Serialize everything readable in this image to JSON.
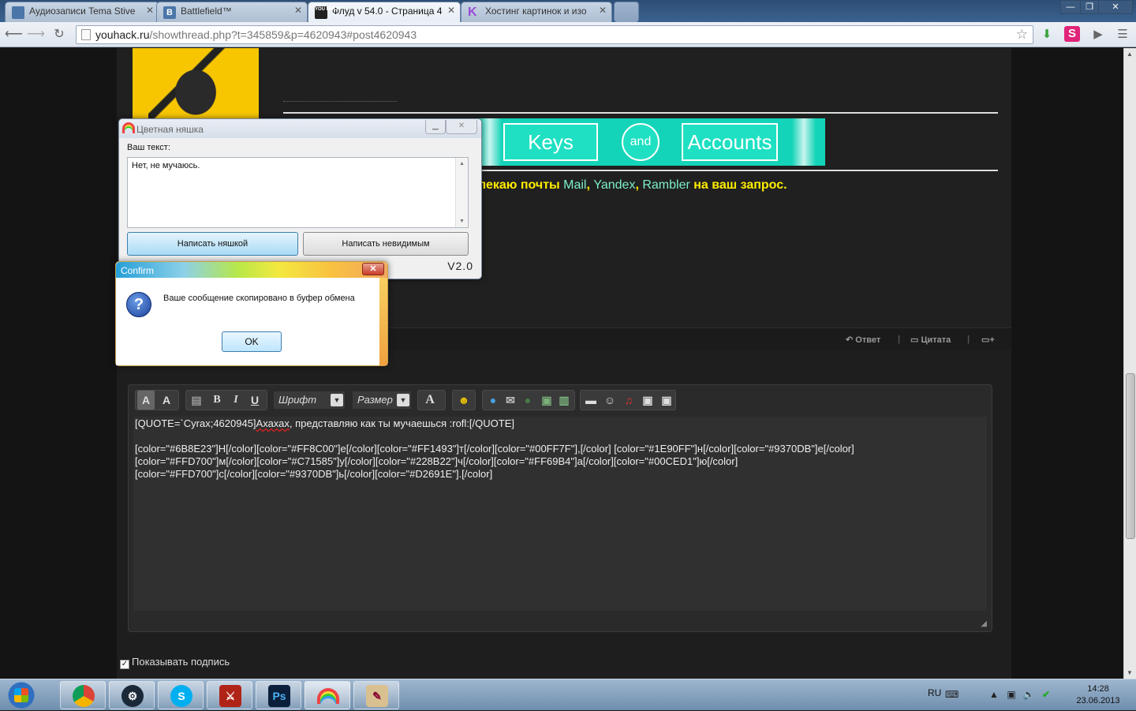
{
  "browser": {
    "tabs": [
      {
        "title": "Аудиозаписи Tema Stive",
        "favicon": "play-icon",
        "color": "#4a76a8"
      },
      {
        "title": "Battlefield™",
        "favicon": "vk-icon",
        "color": "#4a76a8"
      },
      {
        "title": "Флуд v 54.0 - Страница 4",
        "favicon": "youhack-icon",
        "color": "#222222"
      },
      {
        "title": "Хостинг картинок и изо",
        "favicon": "k-icon",
        "color": "#9a4bd6"
      }
    ],
    "url_host": "youhack.ru",
    "url_path": "/showthread.php?t=345859&p=4620943#post4620943"
  },
  "banner": {
    "keys": "Keys",
    "and": "and",
    "accounts": "Accounts"
  },
  "signature": {
    "prefix": "лекаю почты ",
    "mail": "Mail",
    "comma1": ", ",
    "yandex": "Yandex",
    "comma2": ", ",
    "rambler": "Rambler",
    "suffix": " на ваш запрос."
  },
  "post_actions": {
    "reply": "Ответ",
    "quote": "Цитата"
  },
  "editor": {
    "font_label": "Шрифт",
    "size_label": "Размер",
    "quote_line_a": "[QUOTE=`Cyrax;4620945]",
    "quote_word": "Ахахах",
    "quote_line_b": ", представляю как ты мучаешься :rofl:[/QUOTE]",
    "line1": "[color=\"#6B8E23\"]Н[/color][color=\"#FF8C00\"]е[/color][color=\"#FF1493\"]т[/color][color=\"#00FF7F\"],[/color] [color=\"#1E90FF\"]н[/color][color=\"#9370DB\"]е[/color]",
    "line2": "[color=\"#FFD700\"]м[/color][color=\"#C71585\"]у[/color][color=\"#228B22\"]ч[/color][color=\"#FF69B4\"]а[/color][color=\"#00CED1\"]ю[/color]",
    "line3": "[color=\"#FFD700\"]с[/color][color=\"#9370DB\"]ь[/color][color=\"#D2691E\"].[/color]",
    "show_signature": "Показывать подпись"
  },
  "nyashka": {
    "title": "Цветная няшка",
    "text_label": "Ваш текст:",
    "text_value": "Нет, не мучаюсь.",
    "btn_nyashka": "Написать няшкой",
    "btn_invisible": "Написать невидимым",
    "version": "V2.0"
  },
  "confirm": {
    "title": "Confirm",
    "message": "Ваше сообщение скопировано в буфер обмена",
    "ok": "OK"
  },
  "taskbar": {
    "apps": [
      "chrome-icon",
      "steam-icon",
      "skype-icon",
      "dota-icon",
      "photoshop-icon",
      "rainbow-icon",
      "paint-icon"
    ],
    "photoshop_label": "Ps",
    "skype_label": "S",
    "lang": "RU",
    "time": "14:28",
    "date": "23.06.2013"
  }
}
